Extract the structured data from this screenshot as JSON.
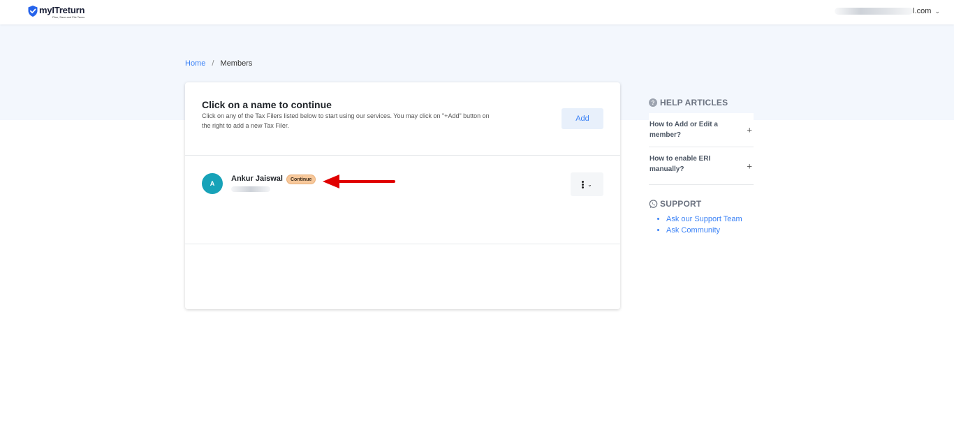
{
  "header": {
    "logo_text": "myITreturn",
    "logo_tagline": "Plan, Save and File Taxes",
    "account_email_visible_suffix": "l.com"
  },
  "breadcrumb": {
    "home": "Home",
    "separator": "/",
    "current": "Members"
  },
  "card": {
    "title": "Click on a name to continue",
    "subtitle": "Click on any of the Tax Filers listed below to start using our services. You may click on \"+Add\" button on the right to add a new Tax Filer.",
    "add_button_label": "Add",
    "members": [
      {
        "initial": "A",
        "name": "Ankur Jaiswal",
        "status_badge": "Continue"
      }
    ]
  },
  "help_articles": {
    "title": "HELP ARTICLES",
    "items": [
      {
        "label": "How to Add or Edit a member?"
      },
      {
        "label": "How to enable ERI manually?"
      }
    ]
  },
  "support": {
    "title": "SUPPORT",
    "links": [
      {
        "label": "Ask our Support Team"
      },
      {
        "label": "Ask Community"
      }
    ]
  },
  "colors": {
    "brand_blue": "#3b82f6",
    "avatar_teal": "#17a2b8",
    "badge_orange": "#f7c89b",
    "hero_band": "#f3f7fd",
    "annotation_arrow_red": "#e00000"
  },
  "icons": {
    "logo": "shield-check-icon",
    "account_dropdown": "chevron-down-icon",
    "row_menu": "kebab-menu-icon",
    "help": "question-circle-icon",
    "expand": "plus-icon",
    "support": "whatsapp-icon"
  }
}
